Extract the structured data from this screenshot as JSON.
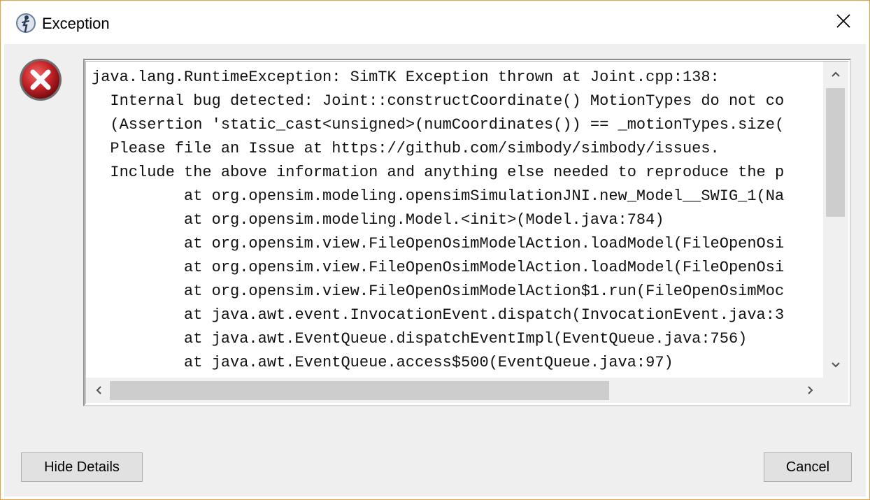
{
  "window": {
    "title": "Exception",
    "app_icon": "opensim-figure-icon",
    "close_icon": "close-x-icon"
  },
  "error": {
    "icon": "error-circle-x-icon",
    "trace_lines": [
      "java.lang.RuntimeException: SimTK Exception thrown at Joint.cpp:138:",
      "  Internal bug detected: Joint::constructCoordinate() MotionTypes do not co",
      "  (Assertion 'static_cast<unsigned>(numCoordinates()) == _motionTypes.size(",
      "  Please file an Issue at https://github.com/simbody/simbody/issues.",
      "  Include the above information and anything else needed to reproduce the p",
      "          at org.opensim.modeling.opensimSimulationJNI.new_Model__SWIG_1(Na",
      "          at org.opensim.modeling.Model.<init>(Model.java:784)",
      "          at org.opensim.view.FileOpenOsimModelAction.loadModel(FileOpenOsi",
      "          at org.opensim.view.FileOpenOsimModelAction.loadModel(FileOpenOsi",
      "          at org.opensim.view.FileOpenOsimModelAction$1.run(FileOpenOsimMoc",
      "          at java.awt.event.InvocationEvent.dispatch(InvocationEvent.java:3",
      "          at java.awt.EventQueue.dispatchEventImpl(EventQueue.java:756)",
      "          at java.awt.EventQueue.access$500(EventQueue.java:97)"
    ]
  },
  "scrollbars": {
    "up_icon": "chevron-up-icon",
    "down_icon": "chevron-down-icon",
    "left_icon": "chevron-left-icon",
    "right_icon": "chevron-right-icon"
  },
  "buttons": {
    "hide_details": "Hide Details",
    "cancel": "Cancel"
  },
  "colors": {
    "window_border": "#e8a040",
    "dialog_background": "#efefef",
    "error_red": "#c8262a",
    "button_face": "#e1e1e1",
    "scroll_thumb": "#cdcdcd"
  }
}
